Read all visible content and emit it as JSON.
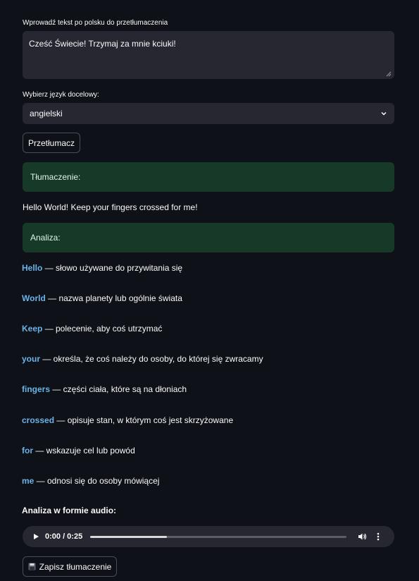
{
  "input": {
    "label": "Wprowadź tekst po polsku do przetłumaczenia",
    "value": "Cześć Świecie! Trzymaj za mnie kciuki!"
  },
  "language": {
    "label": "Wybierz język docelowy:",
    "selected": "angielski"
  },
  "translate_button": "Przetłumacz",
  "translation": {
    "header": "Tłumaczenie:",
    "text": "Hello World! Keep your fingers crossed for me!"
  },
  "analysis": {
    "header": "Analiza:",
    "items": [
      {
        "word": "Hello",
        "desc": " — słowo używane do przywitania się"
      },
      {
        "word": "World",
        "desc": " — nazwa planety lub ogólnie świata"
      },
      {
        "word": "Keep",
        "desc": " — polecenie, aby coś utrzymać"
      },
      {
        "word": "your",
        "desc": " — określa, że coś należy do osoby, do której się zwracamy"
      },
      {
        "word": "fingers",
        "desc": " — części ciała, które są na dłoniach"
      },
      {
        "word": "crossed",
        "desc": " — opisuje stan, w którym coś jest skrzyżowane"
      },
      {
        "word": "for",
        "desc": " — wskazuje cel lub powód"
      },
      {
        "word": "me",
        "desc": " — odnosi się do osoby mówiącej"
      }
    ]
  },
  "audio": {
    "title": "Analiza w formie audio:",
    "time": "0:00 / 0:25",
    "progress": 0.0,
    "buffered": 0.3
  },
  "save_button": "Zapisz tłumaczenie",
  "colors": {
    "background": "#0e1117",
    "field": "#262730",
    "success_banner": "#173928",
    "highlight_word": "#6ab3e8"
  }
}
